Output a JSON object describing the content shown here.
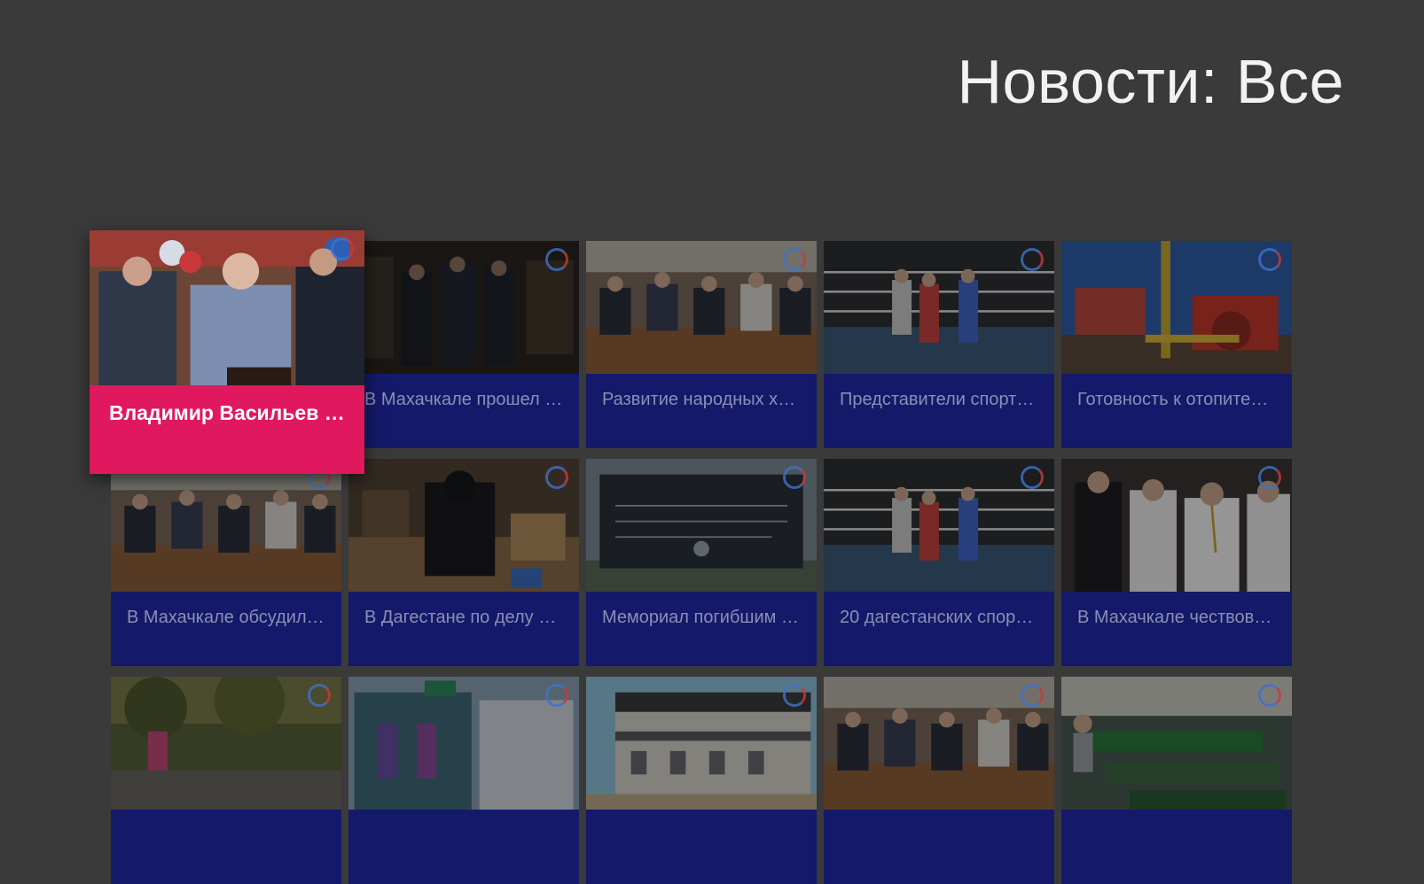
{
  "page": {
    "title": "Новости: Все"
  },
  "colors": {
    "background": "#3a3a3a",
    "card_caption": "#141a69",
    "focus_accent": "#e0195e"
  },
  "news": [
    {
      "title": "Владимир Васильев с…",
      "focused": true,
      "scene": "officials"
    },
    {
      "title": "В Махачкале прошел …",
      "focused": false,
      "scene": "ceremony"
    },
    {
      "title": "Развитие народных х…",
      "focused": false,
      "scene": "meeting"
    },
    {
      "title": "Представители спорт…",
      "focused": false,
      "scene": "boxing"
    },
    {
      "title": "Готовность к отопите…",
      "focused": false,
      "scene": "boiler"
    },
    {
      "title": "В Махачкале обсудил…",
      "focused": false,
      "scene": "meeting"
    },
    {
      "title": "В Дагестане по делу …",
      "focused": false,
      "scene": "office"
    },
    {
      "title": "Мемориал погибшим …",
      "focused": false,
      "scene": "memorial"
    },
    {
      "title": "20 дагестанских спор…",
      "focused": false,
      "scene": "boxing"
    },
    {
      "title": "В Махачкале чествов…",
      "focused": false,
      "scene": "people"
    },
    {
      "title": "",
      "focused": false,
      "scene": "park"
    },
    {
      "title": "",
      "focused": false,
      "scene": "street"
    },
    {
      "title": "",
      "focused": false,
      "scene": "building"
    },
    {
      "title": "",
      "focused": false,
      "scene": "meeting"
    },
    {
      "title": "",
      "focused": false,
      "scene": "factory"
    }
  ]
}
